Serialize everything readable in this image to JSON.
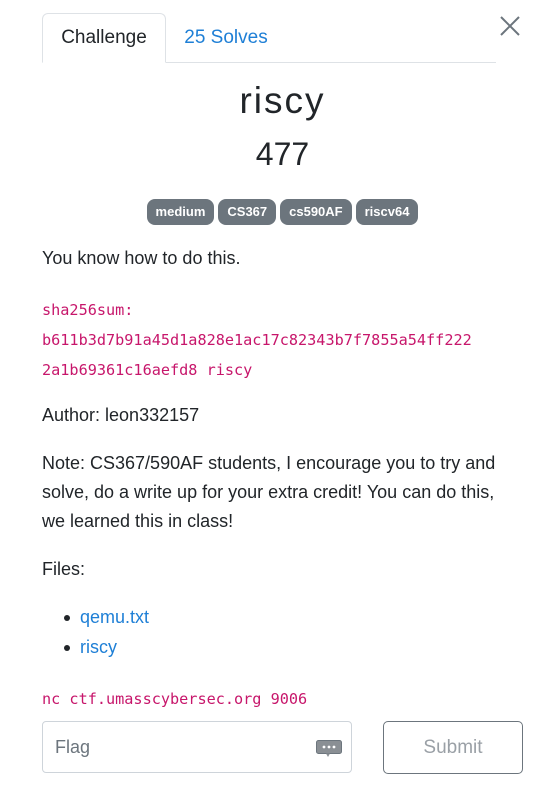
{
  "tabs": [
    {
      "label": "Challenge",
      "active": true
    },
    {
      "label": "25 Solves",
      "active": false
    }
  ],
  "challenge": {
    "name": "riscy",
    "points": "477",
    "tags": [
      "medium",
      "CS367",
      "cs590AF",
      "riscv64"
    ],
    "description": "You know how to do this.",
    "hash_line1": "sha256sum:",
    "hash_line2": "b611b3d7b91a45d1a828e1ac17c82343b7f7855a54ff222",
    "hash_line3": "2a1b69361c16aefd8 riscy",
    "author": "Author: leon332157",
    "note": "Note: CS367/590AF students, I encourage you to try and solve, do a write up for your extra credit! You can do this, we learned this in class!",
    "files_label": "Files:",
    "files": [
      "qemu.txt",
      "riscy"
    ],
    "connection": "nc ctf.umasscybersec.org 9006"
  },
  "form": {
    "flag_placeholder": "Flag",
    "submit_label": "Submit"
  },
  "colors": {
    "link": "#1e7fd6",
    "badge": "#6c757d",
    "code": "#c7166b"
  },
  "icons": {
    "close": "close-icon",
    "key": "password-key-icon"
  }
}
